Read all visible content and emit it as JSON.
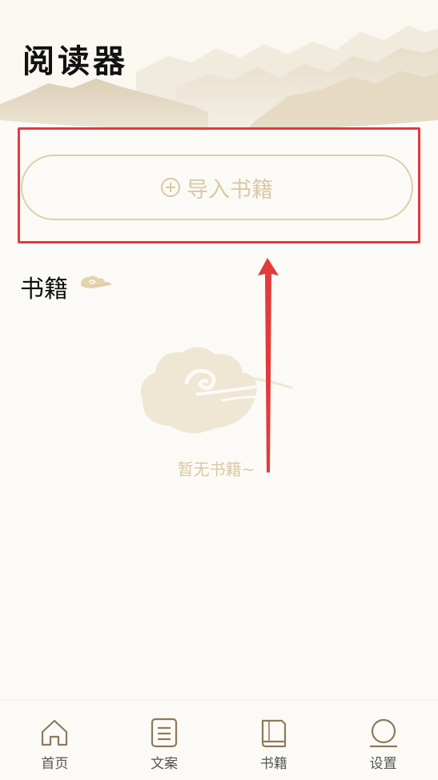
{
  "header": {
    "title": "阅读器"
  },
  "import_button": {
    "label": "导入书籍"
  },
  "books_section": {
    "title": "书籍"
  },
  "empty_state": {
    "text": "暂无书籍~"
  },
  "nav": {
    "items": [
      {
        "label": "首页",
        "icon": "home-icon"
      },
      {
        "label": "文案",
        "icon": "document-icon"
      },
      {
        "label": "书籍",
        "icon": "book-icon"
      },
      {
        "label": "设置",
        "icon": "settings-icon"
      }
    ]
  },
  "colors": {
    "background": "#fcfaf6",
    "accent": "#d9c9a3",
    "highlight": "#e23b3b"
  }
}
